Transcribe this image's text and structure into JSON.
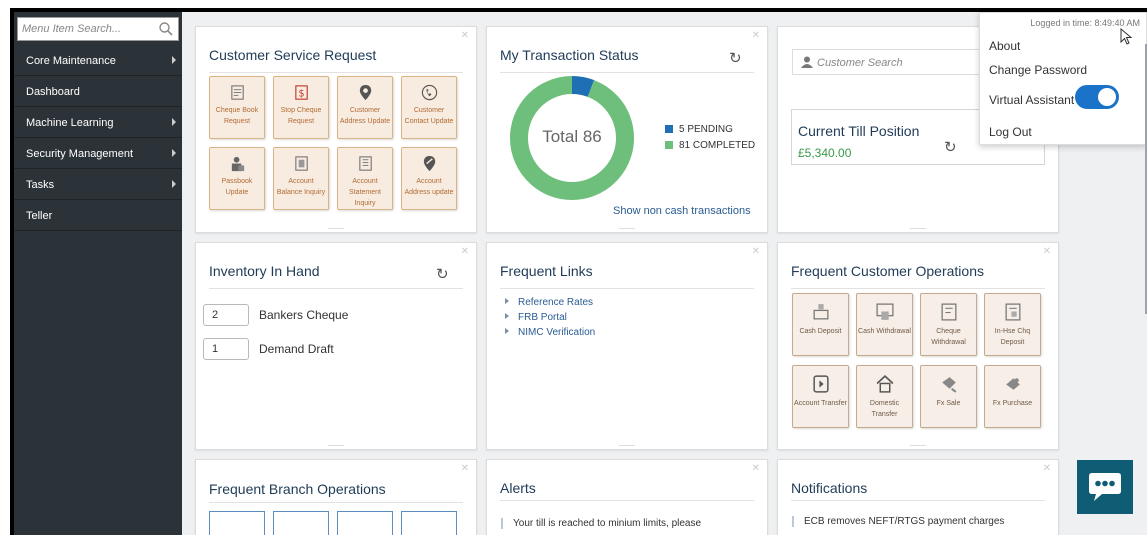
{
  "sidebar": {
    "search_placeholder": "Menu Item Search...",
    "items": [
      {
        "label": "Core Maintenance",
        "has_arrow": true
      },
      {
        "label": "Dashboard",
        "has_arrow": false
      },
      {
        "label": "Machine Learning",
        "has_arrow": true
      },
      {
        "label": "Security Management",
        "has_arrow": true
      },
      {
        "label": "Tasks",
        "has_arrow": true
      },
      {
        "label": "Teller",
        "has_arrow": false
      }
    ]
  },
  "csr": {
    "title": "Customer Service Request",
    "tiles": [
      {
        "label": "Cheque Book Request",
        "icon": "cheque-book-icon"
      },
      {
        "label": "Stop Cheque Request",
        "icon": "stop-cheque-icon"
      },
      {
        "label": "Customer Address Update",
        "icon": "location-pin-icon"
      },
      {
        "label": "Customer Contact Update",
        "icon": "phone-icon"
      },
      {
        "label": "Passbook Update",
        "icon": "passbook-icon"
      },
      {
        "label": "Account Balance Inquiry",
        "icon": "balance-icon"
      },
      {
        "label": "Account Statement Inquiry",
        "icon": "statement-icon"
      },
      {
        "label": "Account Address update",
        "icon": "address-update-icon"
      }
    ]
  },
  "transaction": {
    "title": "My Transaction Status",
    "total_label": "Total 86",
    "pending": 5,
    "completed": 81,
    "pending_label": "5 PENDING",
    "completed_label": "81 COMPLETED",
    "pending_color": "#1f6fb5",
    "completed_color": "#6dbf7b",
    "link": "Show non cash transactions"
  },
  "till": {
    "search_placeholder": "Customer Search",
    "title": "Current Till Position",
    "amount": "£5,340.00"
  },
  "inventory": {
    "title": "Inventory In Hand",
    "items": [
      {
        "count": "2",
        "label": "Bankers Cheque"
      },
      {
        "count": "1",
        "label": "Demand Draft"
      }
    ]
  },
  "links": {
    "title": "Frequent Links",
    "items": [
      "Reference Rates",
      "FRB Portal",
      "NIMC Verification"
    ]
  },
  "fco": {
    "title": "Frequent Customer Operations",
    "tiles": [
      {
        "label": "Cash Deposit",
        "icon": "cash-deposit-icon"
      },
      {
        "label": "Cash Withdrawal",
        "icon": "cash-withdrawal-icon"
      },
      {
        "label": "Cheque Withdrawal",
        "icon": "cheque-withdrawal-icon"
      },
      {
        "label": "In-Hse Chq Deposit",
        "icon": "cheque-deposit-icon"
      },
      {
        "label": "Account Transfer",
        "icon": "account-transfer-icon"
      },
      {
        "label": "Domestic Transfer",
        "icon": "domestic-transfer-icon"
      },
      {
        "label": "Fx Sale",
        "icon": "fx-sale-icon"
      },
      {
        "label": "Fx Purchase",
        "icon": "fx-purchase-icon"
      }
    ]
  },
  "fbo": {
    "title": "Frequent Branch Operations"
  },
  "alerts": {
    "title": "Alerts",
    "message": "Your till is reached to minium limits, please"
  },
  "notifications": {
    "title": "Notifications",
    "message": "ECB removes NEFT/RTGS payment charges"
  },
  "user_menu": {
    "logged_in": "Logged in time: 8:49:40 AM",
    "about": "About",
    "change_password": "Change Password",
    "virtual_assistant": "Virtual Assistant",
    "virtual_assistant_on": true,
    "logout": "Log Out"
  },
  "colors": {
    "sidebar_bg": "#2c3338",
    "accent": "#1a73c9",
    "tile_border": "#d9b48a",
    "amount": "#3a9a4a"
  }
}
